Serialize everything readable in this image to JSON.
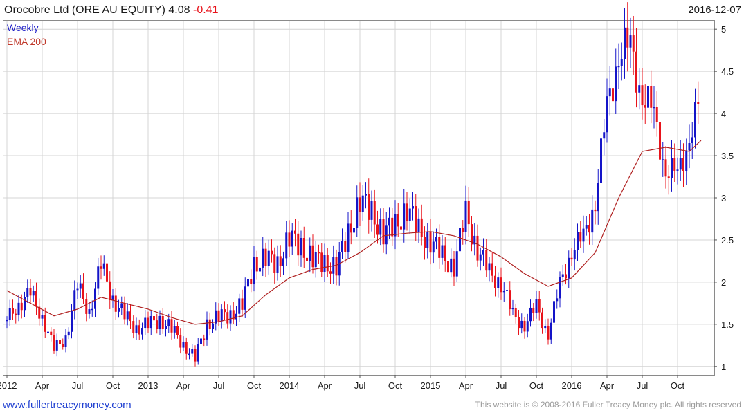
{
  "header": {
    "title": "Orocobre Ltd (ORE AU EQUITY) 4.08",
    "change": "-0.41",
    "date": "2016-12-07"
  },
  "legend": {
    "series1": "Weekly",
    "series2": "EMA 200"
  },
  "footer": {
    "link": "www.fullertreacymoney.com",
    "copyright": "This website is © 2008-2016 Fuller Treacy Money plc. All rights reserved"
  },
  "chart_data": {
    "type": "line",
    "x_tick_labels": [
      "2012",
      "Apr",
      "Jul",
      "Oct",
      "2013",
      "Apr",
      "Jul",
      "Oct",
      "2014",
      "Apr",
      "Jul",
      "Oct",
      "2015",
      "Apr",
      "Jul",
      "Oct",
      "2016",
      "Apr",
      "Jul",
      "Oct"
    ],
    "y_tick_labels": [
      "1",
      "1.5",
      "2",
      "2.5",
      "3",
      "3.5",
      "4",
      "4.5",
      "5"
    ],
    "ylim": [
      0.9,
      5.1
    ],
    "y_axis_side": "right",
    "grid": true,
    "colors": {
      "up": "#1414c8",
      "down": "#e8131b",
      "ema": "#b02020",
      "grid": "#d4d4d4"
    },
    "series": [
      {
        "name": "Weekly",
        "style": "candlestick",
        "x": [
          "2012-01",
          "2012-02",
          "2012-03",
          "2012-04",
          "2012-05",
          "2012-06",
          "2012-07",
          "2012-08",
          "2012-09",
          "2012-10",
          "2012-11",
          "2012-12",
          "2013-01",
          "2013-02",
          "2013-03",
          "2013-04",
          "2013-05",
          "2013-06",
          "2013-07",
          "2013-08",
          "2013-09",
          "2013-10",
          "2013-11",
          "2013-12",
          "2014-01",
          "2014-02",
          "2014-03",
          "2014-04",
          "2014-05",
          "2014-06",
          "2014-07",
          "2014-08",
          "2014-09",
          "2014-10",
          "2014-11",
          "2014-12",
          "2015-01",
          "2015-02",
          "2015-03",
          "2015-04",
          "2015-05",
          "2015-06",
          "2015-07",
          "2015-08",
          "2015-09",
          "2015-10",
          "2015-11",
          "2015-12",
          "2016-01",
          "2016-02",
          "2016-03",
          "2016-04",
          "2016-05",
          "2016-06",
          "2016-07",
          "2016-08",
          "2016-09",
          "2016-10",
          "2016-11",
          "2016-12"
        ],
        "values": [
          1.55,
          1.75,
          1.85,
          1.6,
          1.2,
          1.35,
          1.95,
          1.65,
          2.2,
          1.8,
          1.6,
          1.45,
          1.5,
          1.55,
          1.45,
          1.25,
          1.1,
          1.5,
          1.6,
          1.6,
          1.75,
          2.2,
          2.3,
          2.2,
          2.55,
          2.4,
          2.3,
          2.2,
          2.2,
          2.55,
          3.0,
          2.8,
          2.6,
          2.65,
          2.9,
          2.6,
          2.5,
          2.3,
          2.2,
          2.8,
          2.4,
          2.1,
          2.0,
          1.6,
          1.5,
          1.7,
          1.4,
          1.95,
          2.4,
          2.5,
          3.0,
          4.0,
          4.8,
          4.7,
          4.3,
          3.9,
          3.4,
          3.2,
          3.8,
          4.08
        ]
      },
      {
        "name": "EMA 200",
        "style": "line",
        "x": [
          "2012-01",
          "2012-03",
          "2012-05",
          "2012-07",
          "2012-09",
          "2012-11",
          "2013-01",
          "2013-03",
          "2013-05",
          "2013-07",
          "2013-09",
          "2013-11",
          "2014-01",
          "2014-03",
          "2014-05",
          "2014-07",
          "2014-09",
          "2014-11",
          "2015-01",
          "2015-03",
          "2015-05",
          "2015-07",
          "2015-09",
          "2015-11",
          "2016-01",
          "2016-03",
          "2016-05",
          "2016-07",
          "2016-09",
          "2016-11",
          "2016-12"
        ],
        "values": [
          1.9,
          1.75,
          1.6,
          1.68,
          1.82,
          1.75,
          1.68,
          1.58,
          1.5,
          1.53,
          1.6,
          1.85,
          2.05,
          2.15,
          2.2,
          2.35,
          2.55,
          2.58,
          2.6,
          2.55,
          2.45,
          2.3,
          2.1,
          1.95,
          2.05,
          2.35,
          3.0,
          3.55,
          3.6,
          3.55,
          3.68
        ]
      }
    ]
  }
}
